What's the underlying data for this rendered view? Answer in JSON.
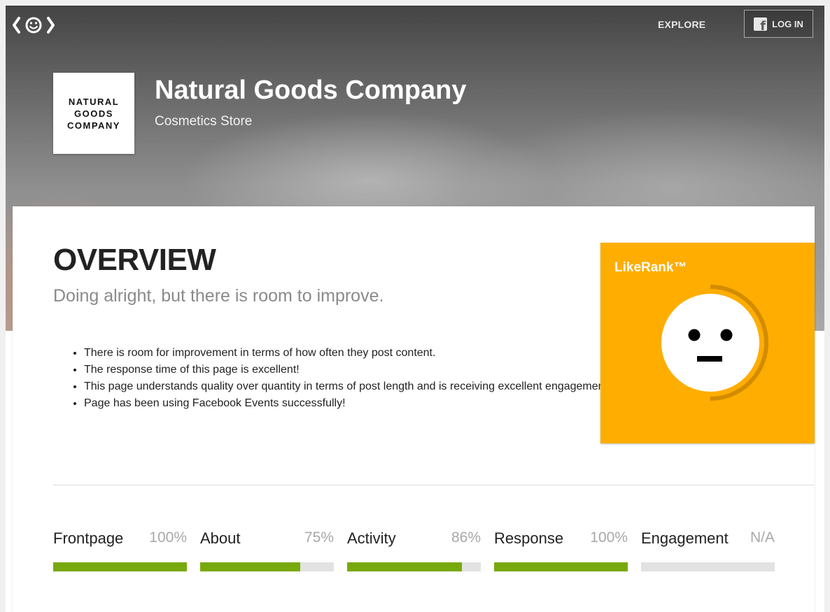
{
  "header": {
    "logo_icon": "eye-smile-logo-icon",
    "explore_label": "EXPLORE",
    "login_label": "LOG IN",
    "login_icon": "facebook-icon"
  },
  "company": {
    "logo_lines": [
      "NATURAL",
      "GOODS",
      "COMPANY"
    ],
    "name": "Natural Goods Company",
    "category": "Cosmetics Store"
  },
  "overview": {
    "title": "OVERVIEW",
    "subtitle": "Doing alright, but there is room to improve.",
    "bullets": [
      "There is room for improvement in terms of how often they post content.",
      "The response time of this page is excellent!",
      "This page understands quality over quantity in terms of post length and is receiving excellent engagement!",
      "Page has been using Facebook Events successfully!"
    ]
  },
  "likerank": {
    "title": "LikeRank™",
    "face_icon": "neutral-face-icon",
    "score_fraction": 0.5,
    "color": "#ffad00"
  },
  "metrics": [
    {
      "label": "Frontpage",
      "value": "100%",
      "fraction": 1.0
    },
    {
      "label": "About",
      "value": "75%",
      "fraction": 0.75
    },
    {
      "label": "Activity",
      "value": "86%",
      "fraction": 0.86
    },
    {
      "label": "Response",
      "value": "100%",
      "fraction": 1.0
    },
    {
      "label": "Engagement",
      "value": "N/A",
      "fraction": 0
    }
  ],
  "colors": {
    "bar_fill": "#78a90c",
    "bar_track": "#e2e2e2",
    "likerank_bg": "#ffad00"
  }
}
